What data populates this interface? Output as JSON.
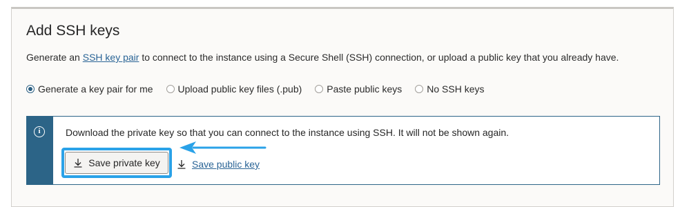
{
  "section": {
    "title": "Add SSH keys",
    "description_before": "Generate an ",
    "description_link": "SSH key pair",
    "description_after": " to connect to the instance using a Secure Shell (SSH) connection, or upload a public key that you already have."
  },
  "radios": [
    {
      "label": "Generate a key pair for me",
      "checked": true
    },
    {
      "label": "Upload public key files (.pub)",
      "checked": false
    },
    {
      "label": "Paste public keys",
      "checked": false
    },
    {
      "label": "No SSH keys",
      "checked": false
    }
  ],
  "notice": {
    "icon": "info-icon",
    "text": "Download the private key so that you can connect to the instance using SSH. It will not be shown again.",
    "save_private_label": "Save private key",
    "save_public_label": "Save public key"
  },
  "colors": {
    "accent": "#2c6487",
    "link": "#2a6496",
    "highlight": "#2aa2e8"
  }
}
